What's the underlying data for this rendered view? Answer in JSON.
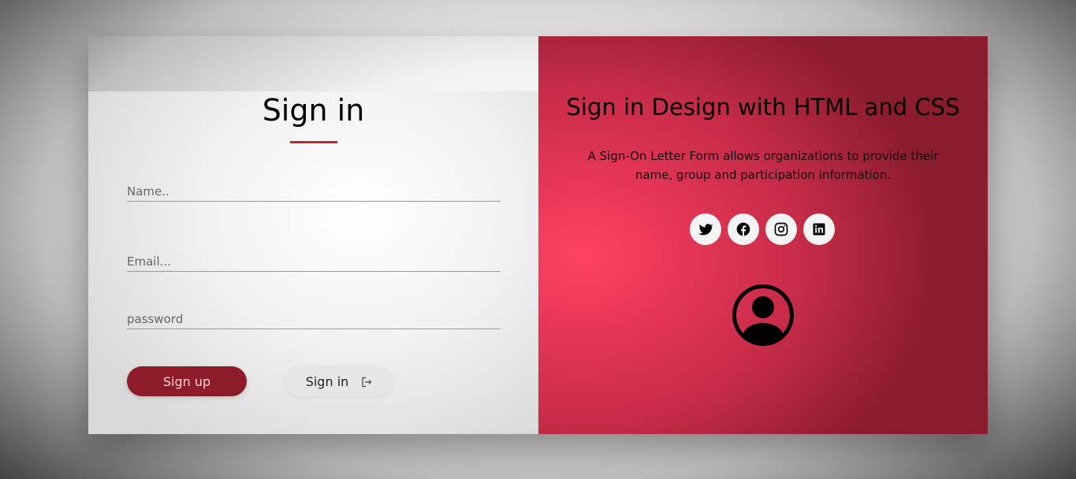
{
  "form": {
    "title": "Sign in",
    "name_placeholder": "Name..",
    "email_placeholder": "Email...",
    "password_placeholder": "password",
    "signup_label": "Sign up",
    "signin_label": "Sign in",
    "accent_color": "#c0282f"
  },
  "info": {
    "title": "Sign in Design with HTML and CSS",
    "description": "A Sign-On Letter Form allows organizations to provide their name, group and participation information.",
    "socials": [
      "twitter-icon",
      "facebook-icon",
      "instagram-icon",
      "linkedin-icon"
    ],
    "panel_color": "#e43556"
  }
}
